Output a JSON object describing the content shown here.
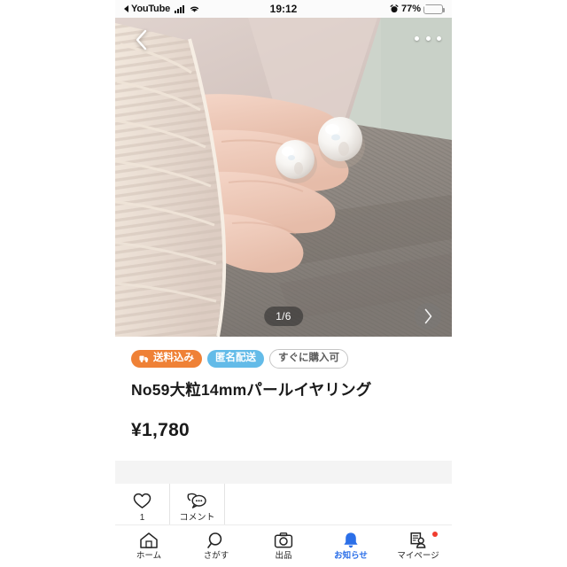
{
  "statusbar": {
    "back_app": "YouTube",
    "back_arrow_icon": "triangle-left-icon",
    "signal_icon": "cellular-signal-icon",
    "wifi_icon": "wifi-icon",
    "time": "19:12",
    "alarm_icon": "alarm-clock-icon",
    "battery_percent": "77%",
    "battery_icon": "battery-charging-icon"
  },
  "hero": {
    "back_icon": "chevron-left-icon",
    "menu_icon": "more-horizontal-icon",
    "counter": "1/6",
    "next_icon": "chevron-right-icon",
    "photo_alt": "hand-holding-pearl-earrings-photo"
  },
  "listing": {
    "badges": [
      {
        "label": "送料込み",
        "type": "shipping-included",
        "icon": "delivery-truck-icon",
        "color": "#ef8136"
      },
      {
        "label": "匿名配送",
        "type": "anonymous-delivery",
        "color": "#63bbe8"
      },
      {
        "label": "すぐに購入可",
        "type": "instant-buy",
        "color": "#5c5c5c"
      }
    ],
    "title": "No59大粒14mmパールイヤリング",
    "price": "¥1,780"
  },
  "actions": [
    {
      "name": "like",
      "icon": "heart-icon",
      "label": "1"
    },
    {
      "name": "comment",
      "icon": "comment-bubble-icon",
      "label": "コメント"
    }
  ],
  "tabbar": {
    "items": [
      {
        "label": "ホーム",
        "icon": "home-icon",
        "active": false,
        "badge": false
      },
      {
        "label": "さがす",
        "icon": "search-icon",
        "active": false,
        "badge": false
      },
      {
        "label": "出品",
        "icon": "camera-icon",
        "active": false,
        "badge": false
      },
      {
        "label": "お知らせ",
        "icon": "bell-icon",
        "active": true,
        "badge": false
      },
      {
        "label": "マイページ",
        "icon": "my-page-icon",
        "active": false,
        "badge": true
      }
    ],
    "active_color": "#2b6fe8",
    "badge_color": "#f03c2e"
  }
}
